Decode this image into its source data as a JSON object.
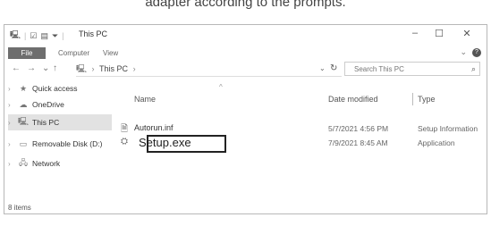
{
  "caption": "adapter according to the prompts.",
  "window": {
    "title": "This PC",
    "controls": {
      "minimize": "–",
      "maximize": "☐",
      "close": "✕"
    }
  },
  "ribbon": {
    "tabs": [
      "File",
      "Computer",
      "View"
    ]
  },
  "address": {
    "back": "←",
    "forward": "→",
    "recent": "⌄",
    "up": "↑",
    "crumbs": [
      "This PC",
      "›"
    ],
    "search_placeholder": "Search This PC"
  },
  "nav_pane": {
    "items": [
      {
        "label": "Quick access",
        "icon": "star-icon"
      },
      {
        "label": "OneDrive",
        "icon": "cloud-icon"
      },
      {
        "label": "This PC",
        "icon": "computer-icon",
        "selected": true
      },
      {
        "label": "Removable Disk (D:)",
        "icon": "removable-disk-icon"
      },
      {
        "label": "Network",
        "icon": "network-icon"
      }
    ]
  },
  "columns": {
    "name": "Name",
    "date": "Date modified",
    "type": "Type"
  },
  "files": [
    {
      "name": "Autorun.inf",
      "date": "5/7/2021 4:56 PM",
      "type": "Setup Information"
    },
    {
      "name": "Setup.exe",
      "date": "7/9/2021 8:45 AM",
      "type": "Application"
    }
  ],
  "status": {
    "items": "8 items"
  }
}
